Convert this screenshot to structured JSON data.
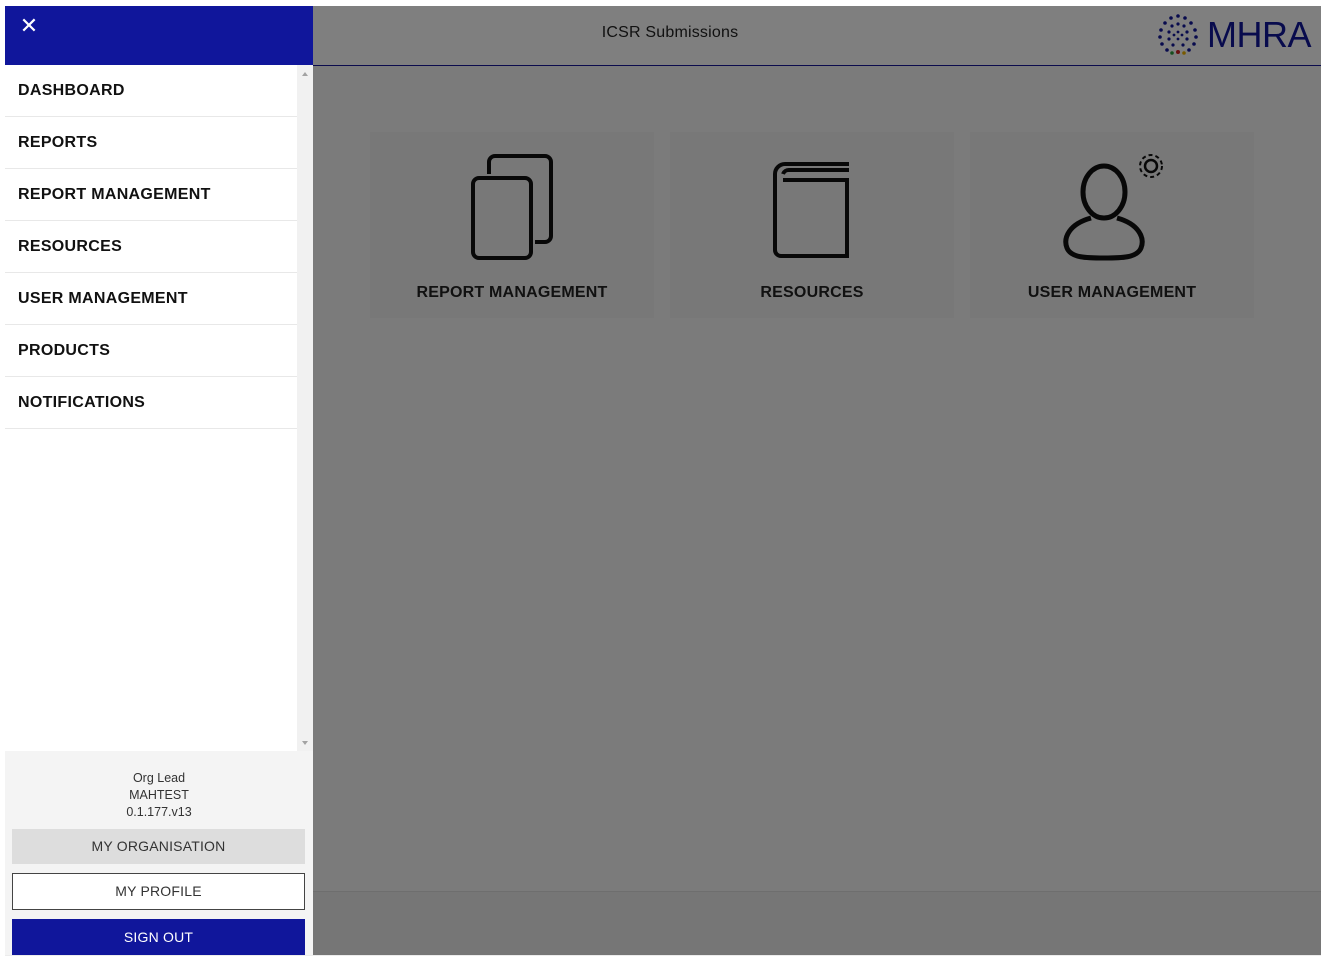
{
  "header": {
    "title": "ICSR Submissions",
    "logo_text": "MHRA",
    "brand_color": "#10169b"
  },
  "tiles": [
    {
      "label": "REPORT MANAGEMENT",
      "icon": "documents-icon"
    },
    {
      "label": "RESOURCES",
      "icon": "book-icon"
    },
    {
      "label": "USER MANAGEMENT",
      "icon": "user-settings-icon"
    }
  ],
  "drawer": {
    "close_icon": "close-icon",
    "nav": [
      "DASHBOARD",
      "REPORTS",
      "REPORT MANAGEMENT",
      "RESOURCES",
      "USER MANAGEMENT",
      "PRODUCTS",
      "NOTIFICATIONS"
    ],
    "user": {
      "role": "Org Lead",
      "org": "MAHTEST",
      "version": "0.1.177.v13"
    },
    "buttons": {
      "organisation": "MY ORGANISATION",
      "profile": "MY PROFILE",
      "signout": "SIGN OUT"
    }
  }
}
